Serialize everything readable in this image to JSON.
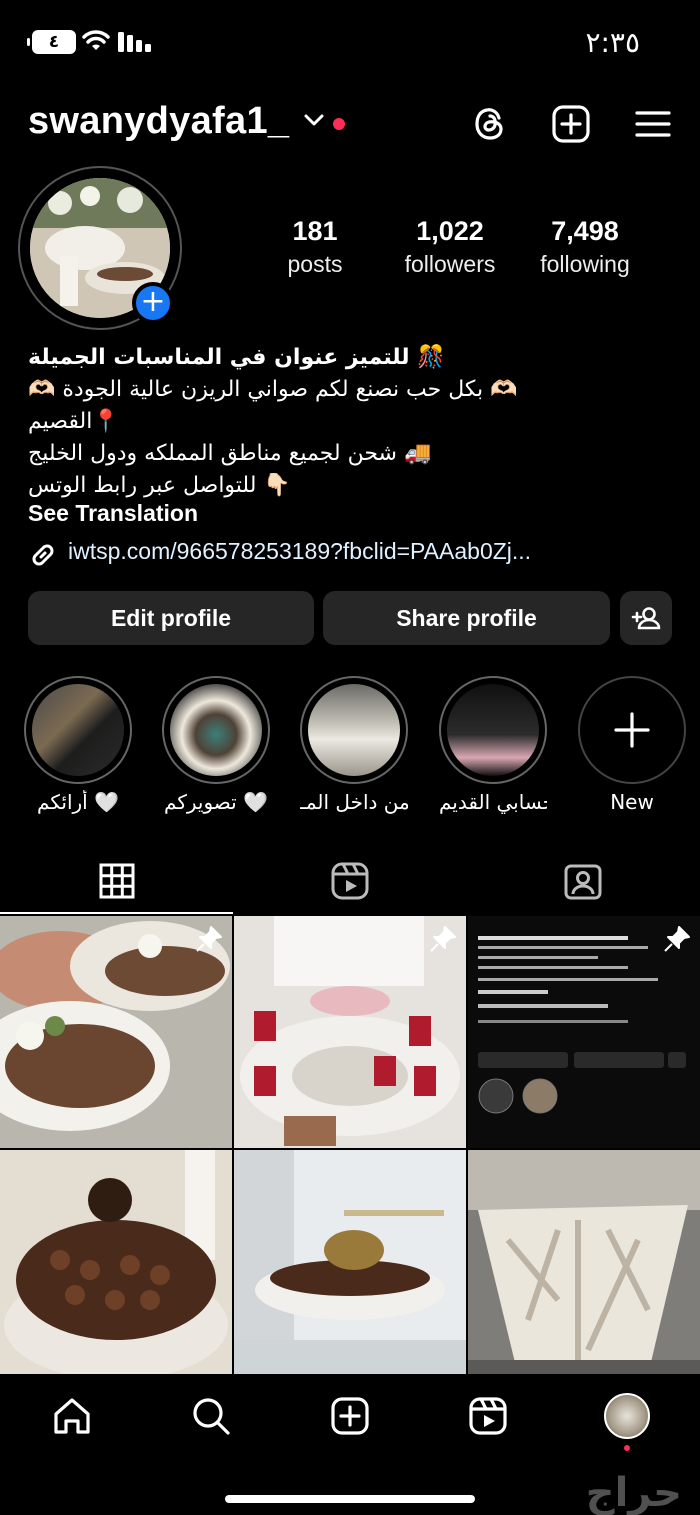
{
  "status_bar": {
    "time": "٢:٣٥",
    "battery": "٤"
  },
  "header": {
    "username": "swanydyafa1_",
    "icons": [
      "threads-icon",
      "plus-square-icon",
      "menu-icon"
    ]
  },
  "stats": [
    {
      "value": "181",
      "label": "posts"
    },
    {
      "value": "1,022",
      "label": "followers"
    },
    {
      "value": "7,498",
      "label": "following"
    }
  ],
  "bio": {
    "lines": [
      "للتميز عنوان في المناسبات الجميلة 🎊",
      "🫶🏻 بكل حب نصنع لكم صواني الريزن عالية الجودة 🫶🏻",
      "القصيم📍",
      "شحن لجميع مناطق المملكه ودول الخليج 🚚",
      "للتواصل عبر رابط الوتس 👇🏻"
    ],
    "see_translation": "See Translation",
    "link": "iwtsp.com/966578253189?fbclid=PAAab0Zj..."
  },
  "buttons": {
    "edit": "Edit profile",
    "share": "Share profile"
  },
  "highlights": [
    {
      "caption": "أرائكم 🤍"
    },
    {
      "caption": "تصويركم 🤍"
    },
    {
      "caption": "من داخل المـ..."
    },
    {
      "caption": "حسابي القديم..."
    },
    {
      "caption": "New"
    }
  ],
  "tabs": [
    "grid-icon",
    "reels-icon",
    "tagged-icon"
  ],
  "nav": [
    "home-icon",
    "search-icon",
    "create-icon",
    "reels-icon",
    "profile-avatar"
  ],
  "watermark": "حراج"
}
